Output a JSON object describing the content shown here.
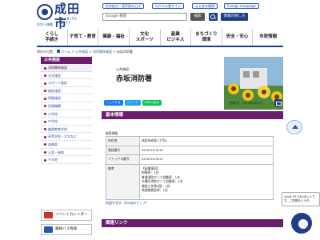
{
  "header": {
    "logo_text": "成田市",
    "logo_sub": "NARITA CITY",
    "top_link": "本文へ移動",
    "util_links": [
      "文字拡大・音声読み上げ",
      "ホバイル版サイト",
      "よくある質問",
      "Foreign Language"
    ],
    "search_placeholder": "Google 検索",
    "search_button": "検索",
    "info_button": "情報の探し方"
  },
  "gnav": [
    {
      "line1": "くらし",
      "line2": "手続き"
    },
    {
      "line1": "子育て・教育",
      "line2": ""
    },
    {
      "line1": "健康・福祉",
      "line2": ""
    },
    {
      "line1": "文化",
      "line2": "スポーツ"
    },
    {
      "line1": "産業",
      "line2": "ビジネス"
    },
    {
      "line1": "まちづくり",
      "line2": "環境"
    },
    {
      "line1": "安全・安心",
      "line2": ""
    },
    {
      "line1": "市政情報",
      "line2": ""
    }
  ],
  "breadcrumb": {
    "current_label": "現在の位置：",
    "items": [
      "ホーム",
      "公共施設",
      "消防関係施設",
      "赤坂消防署"
    ]
  },
  "sidebar": {
    "heading": "公共施設",
    "items": [
      "消防関係施設",
      "文化施設",
      "スポーツ施設",
      "福祉施設",
      "保健施設",
      "医療機関",
      "小学校",
      "中学校",
      "義務教育学校",
      "高等学校・大学など",
      "幼稚園",
      "公園・緑地",
      "その他"
    ],
    "current_index": 0
  },
  "banners": {
    "event_calendar": "イベントカレンダー",
    "bus_info": "路線バス情報"
  },
  "content": {
    "category": "公共施設",
    "title": "赤坂消防署",
    "social": [
      "シェアする",
      "ツイート",
      "LINEで送る"
    ],
    "date": "更新日：2017年4月1日",
    "section_basic": "基本情報",
    "facility_info_label": "施設情報",
    "table": [
      {
        "label": "所在地",
        "value": "成田市赤坂1丁目4"
      },
      {
        "label": "電話番号",
        "value": "0476-26-3210"
      },
      {
        "label": "ファックス番号",
        "value": "0476-26-3217"
      },
      {
        "label": "備考",
        "lines": [
          "【配備車両】",
          "指揮車：1台",
          "普通消防ポンプ自動車：1台",
          "水槽付消防ポンプ自動車：1台",
          "救助工作車Ⅲ型：1台",
          "高規格救急車：1台"
        ]
      }
    ],
    "map_link": "地図を見る（Googleマップ）",
    "section_related": "関連リンク"
  },
  "chat": {
    "text": "covid-19 Q＆Aボットです。ご質問をどうぞ。"
  }
}
